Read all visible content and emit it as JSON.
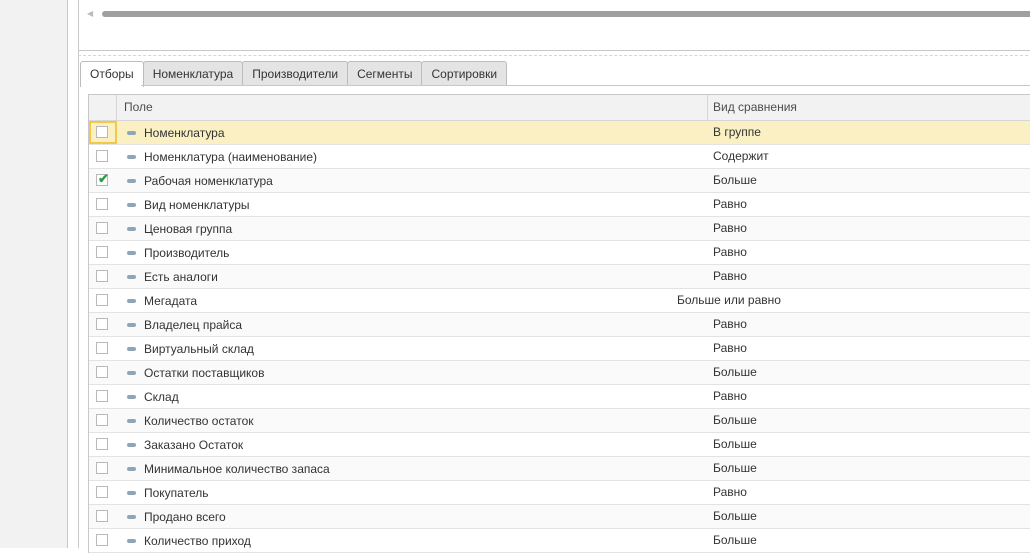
{
  "tabs": [
    "Отборы",
    "Номенклатура",
    "Производители",
    "Сегменты",
    "Сортировки"
  ],
  "active_tab": 0,
  "columns": {
    "field": "Поле",
    "comparison": "Вид сравнения"
  },
  "rows": [
    {
      "field": "Номенклатура",
      "comparison": "В группе",
      "checked": false,
      "selected": true
    },
    {
      "field": "Номенклатура (наименование)",
      "comparison": "Содержит",
      "checked": false
    },
    {
      "field": "Рабочая номенклатура",
      "comparison": "Больше",
      "checked": true
    },
    {
      "field": "Вид номенклатуры",
      "comparison": "Равно",
      "checked": false
    },
    {
      "field": "Ценовая группа",
      "comparison": "Равно",
      "checked": false
    },
    {
      "field": "Производитель",
      "comparison": "Равно",
      "checked": false
    },
    {
      "field": "Есть аналоги",
      "comparison": "Равно",
      "checked": false
    },
    {
      "field": "Мегадата",
      "comparison": "Больше или равно",
      "checked": false,
      "overflow": true
    },
    {
      "field": "Владелец прайса",
      "comparison": "Равно",
      "checked": false
    },
    {
      "field": "Виртуальный склад",
      "comparison": "Равно",
      "checked": false
    },
    {
      "field": "Остатки поставщиков",
      "comparison": "Больше",
      "checked": false
    },
    {
      "field": "Склад",
      "comparison": "Равно",
      "checked": false
    },
    {
      "field": "Количество остаток",
      "comparison": "Больше",
      "checked": false
    },
    {
      "field": "Заказано Остаток",
      "comparison": "Больше",
      "checked": false
    },
    {
      "field": "Минимальное количество запаса",
      "comparison": "Больше",
      "checked": false
    },
    {
      "field": "Покупатель",
      "comparison": "Равно",
      "checked": false
    },
    {
      "field": "Продано всего",
      "comparison": "Больше",
      "checked": false
    },
    {
      "field": "Количество приход",
      "comparison": "Больше",
      "checked": false
    }
  ],
  "colors": {
    "selected_row": "#fbf0c3",
    "check": "#2e9e3c"
  }
}
